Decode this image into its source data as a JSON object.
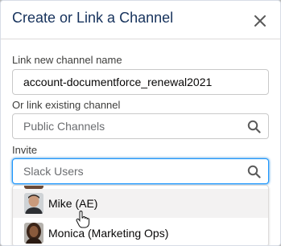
{
  "modal": {
    "title": "Create or Link a Channel",
    "close_icon": "close-icon"
  },
  "form": {
    "new_channel_label": "Link new channel name",
    "new_channel_value": "account-documentforce_renewal2021",
    "existing_channel_label": "Or link existing channel",
    "existing_channel_placeholder": "Public Channels",
    "invite_label": "Invite",
    "invite_placeholder": "Slack Users"
  },
  "dropdown": {
    "options": [
      {
        "label": "Mike (AE)",
        "avatar": "user-avatar-mike",
        "hovered": true
      },
      {
        "label": "Monica (Marketing Ops)",
        "avatar": "user-avatar-monica",
        "hovered": false
      }
    ]
  },
  "colors": {
    "title_text": "#16325c",
    "focus_border": "#1b96ff",
    "hover_bg": "#f3f2f2"
  }
}
